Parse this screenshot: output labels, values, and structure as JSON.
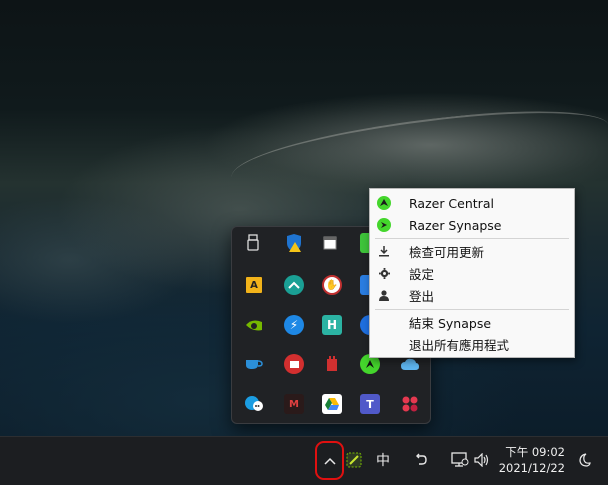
{
  "menu": {
    "items": [
      {
        "label": "Razer Central",
        "icon": "razer-logo-icon"
      },
      {
        "label": "Razer Synapse",
        "icon": "razer-synapse-icon"
      },
      {
        "label": "檢查可用更新",
        "icon": "download-icon"
      },
      {
        "label": "設定",
        "icon": "gear-icon"
      },
      {
        "label": "登出",
        "icon": "person-icon"
      },
      {
        "label": "結束 Synapse",
        "icon": ""
      },
      {
        "label": "退出所有應用程式",
        "icon": ""
      }
    ]
  },
  "tray": {
    "icons": [
      "usb-drive-icon",
      "shield-warning-icon",
      "window-app-icon",
      "green-app-icon",
      "yellow-app-icon",
      "teal-arrow-icon",
      "hand-icon",
      "blue-app-icon",
      "nvidia-icon",
      "lightning-icon",
      "h-app-icon",
      "bluetooth-icon",
      "cup-icon",
      "red-box-icon",
      "red-dots-icon",
      "razer-tray-icon",
      "edge-chat-icon",
      "m-app-icon",
      "google-drive-icon",
      "teams-icon"
    ]
  },
  "taskbar": {
    "ime_label": "中",
    "time": "下午 09:02",
    "date": "2021/12/22"
  },
  "colors": {
    "razer_green": "#44d62c",
    "highlight_red": "#e01010",
    "taskbar_bg": "#1c1e21"
  }
}
